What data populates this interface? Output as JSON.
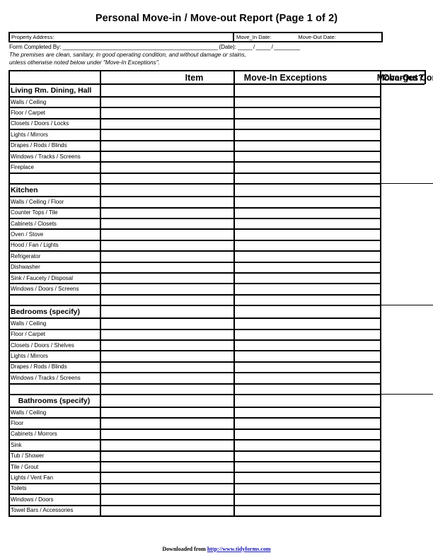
{
  "document": {
    "title": "Personal Move-in / Move-out Report (Page 1 of 2)",
    "property_address_label": "Property Address:",
    "move_in_date_label": "Move_In Date:",
    "move_out_date_label": "Move-Out Date:",
    "form_completed_label": "Form Completed  By: ",
    "form_completed_rule": "______________________________________________________",
    "date_label": " (Date): ",
    "date_rule": "_____ / _____ / _________",
    "premises_line1": "The premises are clean, sanitary, in good operating condition, and without damage or stains,",
    "premises_line2": "unless otherwise noted below under \"Move-In Exceptions\"."
  },
  "table": {
    "headers": {
      "item": "Item",
      "move_in": "Move-In Exceptions",
      "move_out": "Move-Out Condition",
      "charges": "Charges?"
    },
    "sections": [
      {
        "title": "Living Rm. Dining, Hall",
        "centered": false,
        "rows": [
          "Walls / Ceiling",
          "Floor / Carpet",
          "Closets / Doors / Locks",
          "Lights / Mirrors",
          "Drapes / Rods / Blinds",
          "Windows / Tracks / Screens",
          "Fireplace",
          ""
        ]
      },
      {
        "title": "Kitchen",
        "centered": false,
        "rows": [
          "Walls / Ceiling / Floor",
          "Counter Tops / Tile",
          "Cabinets / Closets",
          "Oven / Stove",
          "Hood / Fan / Lights",
          "Refrigerator",
          "Dishwasher",
          "Sink / Faucety / Disposal",
          "Windows / Doors / Screens",
          ""
        ]
      },
      {
        "title": "Bedrooms (specify)",
        "centered": false,
        "rows": [
          "Walls / Ceiling",
          "Floor / Carpet",
          "Closets / Doors / Shelves",
          "Lights / Mirrors",
          "Drapes / Rods / Blinds",
          "Windows / Tracks / Screens",
          ""
        ]
      },
      {
        "title": "Bathrooms (specify)",
        "centered": true,
        "rows": [
          "Walls / Ceiling",
          "Floor",
          "Cabinets / Morrors",
          "Sink",
          "Tub / Shower",
          "Tile / Grout",
          "Lights / Vent Fan",
          "Toilets",
          "Windows / Doors",
          "Towel Bars / Accessories"
        ]
      }
    ]
  },
  "footer": {
    "prefix": "Downloaded from ",
    "url": "http://www.tidyforms.com"
  },
  "colors": {
    "ink": "#000000",
    "link": "#1414b4",
    "paper": "#ffffff"
  }
}
